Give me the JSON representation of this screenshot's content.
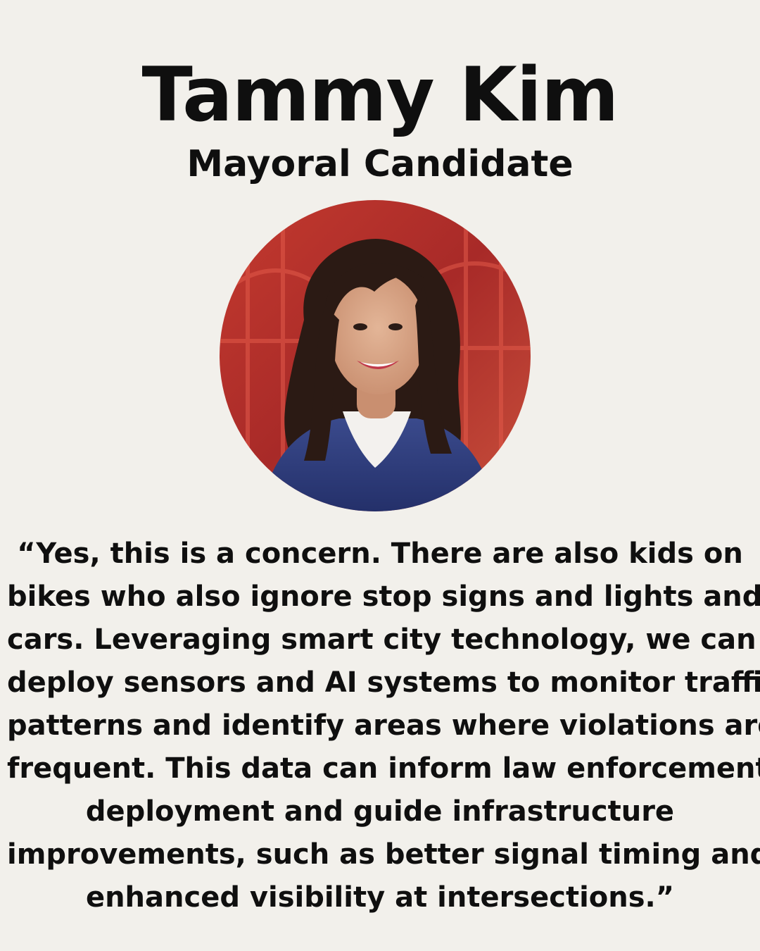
{
  "candidate": {
    "name": "Tammy Kim",
    "role": "Mayoral Candidate"
  },
  "quote": {
    "lines": [
      "“Yes, this is a concern. There are also kids on",
      "bikes who also ignore stop signs and lights and",
      "cars. Leveraging smart city technology, we can",
      "deploy sensors and AI systems to monitor traffic",
      "patterns and identify areas where violations are",
      "frequent. This data can inform law enforcement",
      "deployment and guide infrastructure",
      "improvements, such as better signal timing and",
      "enhanced visibility at intersections.”"
    ]
  },
  "colors": {
    "background": "#f2f0eb",
    "text": "#0f0f0f",
    "photo_background": "#b8322c",
    "hair": "#2b1a14",
    "skin": "#d9a98a",
    "jacket": "#2f3d78",
    "sweater": "#f3f1ee"
  }
}
